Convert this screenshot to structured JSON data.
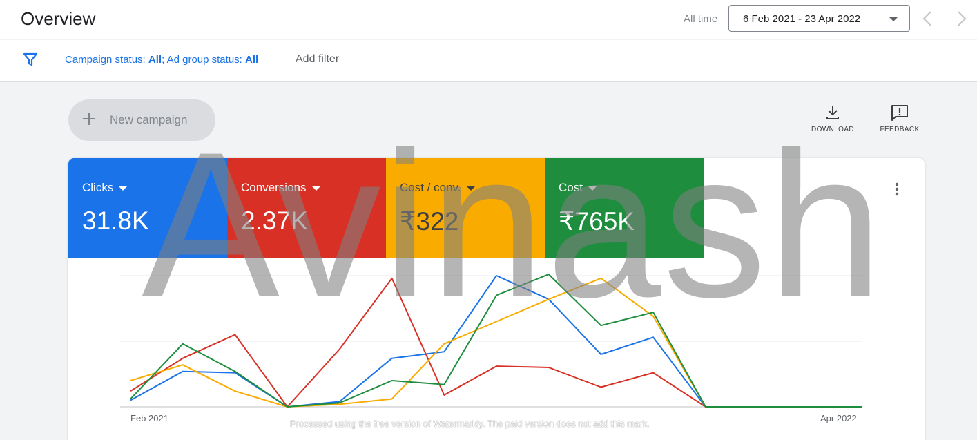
{
  "header": {
    "title": "Overview",
    "all_time_label": "All time",
    "date_range": "6 Feb 2021 - 23 Apr 2022"
  },
  "filter": {
    "campaign_status_label": "Campaign status: ",
    "campaign_status_value": "All",
    "separator": "; ",
    "ad_group_status_label": "Ad group status: ",
    "ad_group_status_value": "All",
    "add_filter_label": "Add filter"
  },
  "actions": {
    "new_campaign_label": "New campaign",
    "download_label": "DOWNLOAD",
    "feedback_label": "FEEDBACK"
  },
  "metrics": [
    {
      "label": "Clicks",
      "value": "31.8K",
      "color": "#1a73e8"
    },
    {
      "label": "Conversions",
      "value": "2.37K",
      "color": "#d93025"
    },
    {
      "label": "Cost / conv.",
      "value": "₹322",
      "color": "#f9ab00"
    },
    {
      "label": "Cost",
      "value": "₹765K",
      "color": "#1e8e3e"
    }
  ],
  "chart_data": {
    "type": "line",
    "x_start_label": "Feb 2021",
    "x_end_label": "Apr 2022",
    "grid": true,
    "series": [
      {
        "color": "#1a73e8",
        "values": [
          0.05,
          0.27,
          0.26,
          0.0,
          0.04,
          0.37,
          0.42,
          1.0,
          0.82,
          0.4,
          0.53,
          0.0,
          0.0,
          0.0,
          0.0
        ]
      },
      {
        "color": "#d93025",
        "values": [
          0.12,
          0.37,
          0.55,
          0.0,
          0.44,
          0.98,
          0.09,
          0.31,
          0.3,
          0.15,
          0.26,
          0.0,
          0.0,
          0.0,
          0.0
        ]
      },
      {
        "color": "#f9ab00",
        "values": [
          0.2,
          0.32,
          0.12,
          0.0,
          0.02,
          0.06,
          0.48,
          0.65,
          0.82,
          0.98,
          0.69,
          0.0,
          0.0,
          0.0,
          0.0
        ]
      },
      {
        "color": "#1e8e3e",
        "values": [
          0.06,
          0.48,
          0.27,
          0.0,
          0.03,
          0.2,
          0.17,
          0.85,
          1.01,
          0.62,
          0.72,
          0.0,
          0.0,
          0.0,
          0.0
        ]
      }
    ]
  },
  "overlay": {
    "watermark": "Avinash",
    "notice": "Processed using the free version of Watermarkly. The paid version does not add this mark."
  }
}
